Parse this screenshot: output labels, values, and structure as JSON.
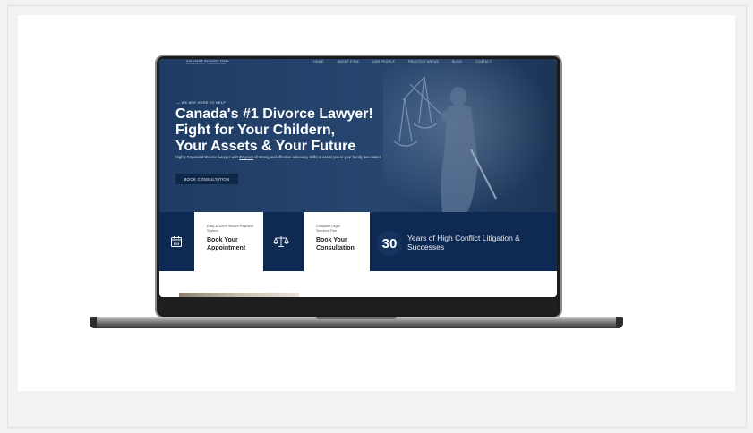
{
  "site": {
    "logo_line1": "GOLDFARB SHULMAN PATEL",
    "logo_line2": "PROFESSIONAL CORPORATION",
    "nav": [
      "HOME",
      "ABOUT FIRM",
      "OUR PEOPLE",
      "PRACTICE AREAS",
      "BLOG",
      "CONTACT"
    ]
  },
  "hero": {
    "eyebrow": "— WE ARE HERE TO HELP",
    "title_line1": "Canada's #1 Divorce Lawyer!",
    "title_line2": "Fight for Your Childern,",
    "title_line3": "Your Assets & Your Future",
    "subtitle_before": "Highly Regarded Divorce Lawyer with ",
    "subtitle_link": "30 years",
    "subtitle_after": " of strong and effective advocacy skills to assist you in your family law matter.",
    "cta_label": "BOOK CONSULTATION"
  },
  "features": {
    "card1_small": "Easy & 100% Secure Payment System",
    "card1_big": "Book Your Appointment",
    "card2_small": "Complete Legal Services Firm",
    "card2_big": "Book Your Consultation",
    "years_number": "30",
    "years_text": "Years of High Conflict Litigation & Successes"
  },
  "icons": {
    "calendar": "calendar-icon",
    "scales": "scales-icon"
  },
  "colors": {
    "navy": "#0e2a52",
    "hero_blue": "#27466f",
    "white": "#ffffff",
    "page_bg": "#f2f2f2"
  }
}
